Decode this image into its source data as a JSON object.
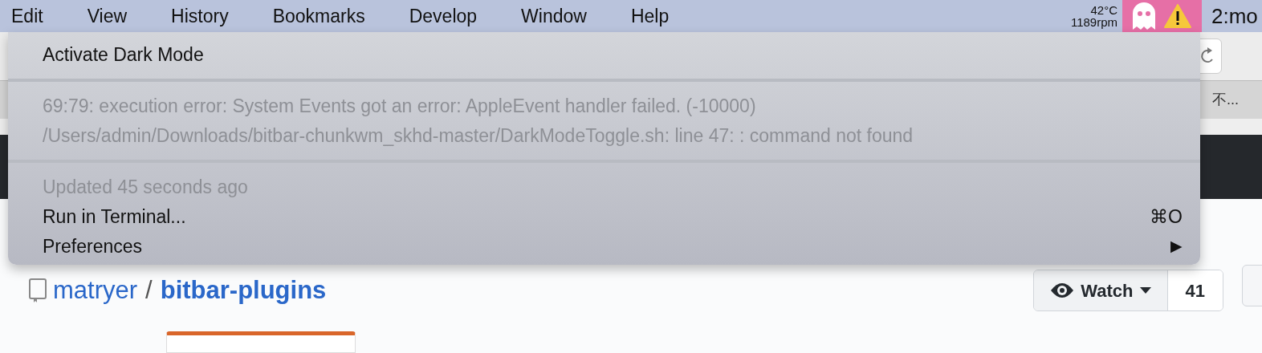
{
  "menu_bar": {
    "items": [
      {
        "label": "Edit"
      },
      {
        "label": "View"
      },
      {
        "label": "History"
      },
      {
        "label": "Bookmarks"
      },
      {
        "label": "Develop"
      },
      {
        "label": "Window"
      },
      {
        "label": "Help"
      }
    ],
    "sensors": {
      "temperature": "42°C",
      "fan": "1189rpm"
    },
    "status_item": {
      "selected": true
    },
    "clock": "2:mo"
  },
  "dropdown": {
    "items": [
      {
        "kind": "item",
        "label": "Activate Dark Mode",
        "disabled": false
      },
      {
        "kind": "separator"
      },
      {
        "kind": "item",
        "label": "69:79: execution error: System Events got an error: AppleEvent handler failed. (-10000)",
        "disabled": true
      },
      {
        "kind": "item",
        "label": "/Users/admin/Downloads/bitbar-chunkwm_skhd-master/DarkModeToggle.sh: line 47: : command not found",
        "disabled": true
      },
      {
        "kind": "separator"
      },
      {
        "kind": "item",
        "label": "Updated 45 seconds ago",
        "disabled": true
      },
      {
        "kind": "item",
        "label": "Run in Terminal...",
        "shortcut": "⌘O",
        "disabled": false
      },
      {
        "kind": "submenu",
        "label": "Preferences",
        "arrow": "▶",
        "disabled": false
      }
    ]
  },
  "browser": {
    "tab_text": "不...",
    "repo": {
      "owner": "matryer",
      "separator": "/",
      "name": "bitbar-plugins"
    },
    "watch": {
      "label": "Watch",
      "count": "41"
    }
  }
}
